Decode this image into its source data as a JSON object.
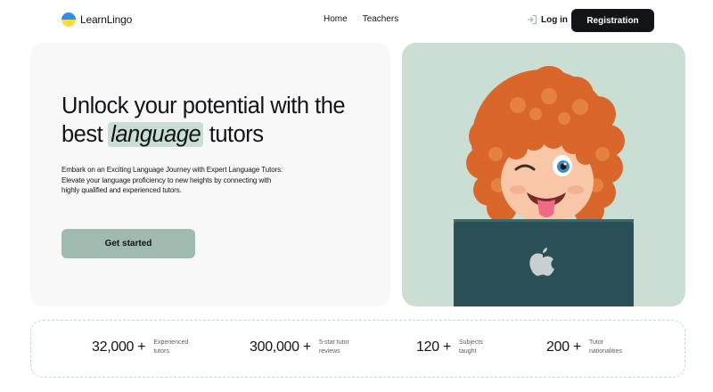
{
  "header": {
    "brand": "LearnLingo",
    "nav": [
      "Home",
      "Teachers"
    ],
    "login_label": "Log in",
    "register_label": "Registration"
  },
  "hero": {
    "title_part1": "Unlock your potential with the best",
    "title_highlight": "language",
    "title_part2": "tutors",
    "description": "Embark on an Exciting Language Journey with Expert Language Tutors: Elevate your language proficiency to new heights by connecting with highly qualified and experienced tutors.",
    "cta_label": "Get started"
  },
  "stats": [
    {
      "value": "32,000 +",
      "label_line1": "Experienced",
      "label_line2": "tutors"
    },
    {
      "value": "300,000 +",
      "label_line1": "5-star tutor",
      "label_line2": "reviews"
    },
    {
      "value": "120 +",
      "label_line1": "Subjects",
      "label_line2": "taught"
    },
    {
      "value": "200 +",
      "label_line1": "Tutor",
      "label_line2": "nationalities"
    }
  ],
  "colors": {
    "accent_bg": "#cbded3",
    "button": "#9fbaae",
    "dark": "#121417",
    "stats_border": "#bfd6ea"
  },
  "icons": {
    "logo": "ukraine-flag-icon",
    "login": "login-arrow-icon",
    "laptop": "apple-logo-icon"
  }
}
